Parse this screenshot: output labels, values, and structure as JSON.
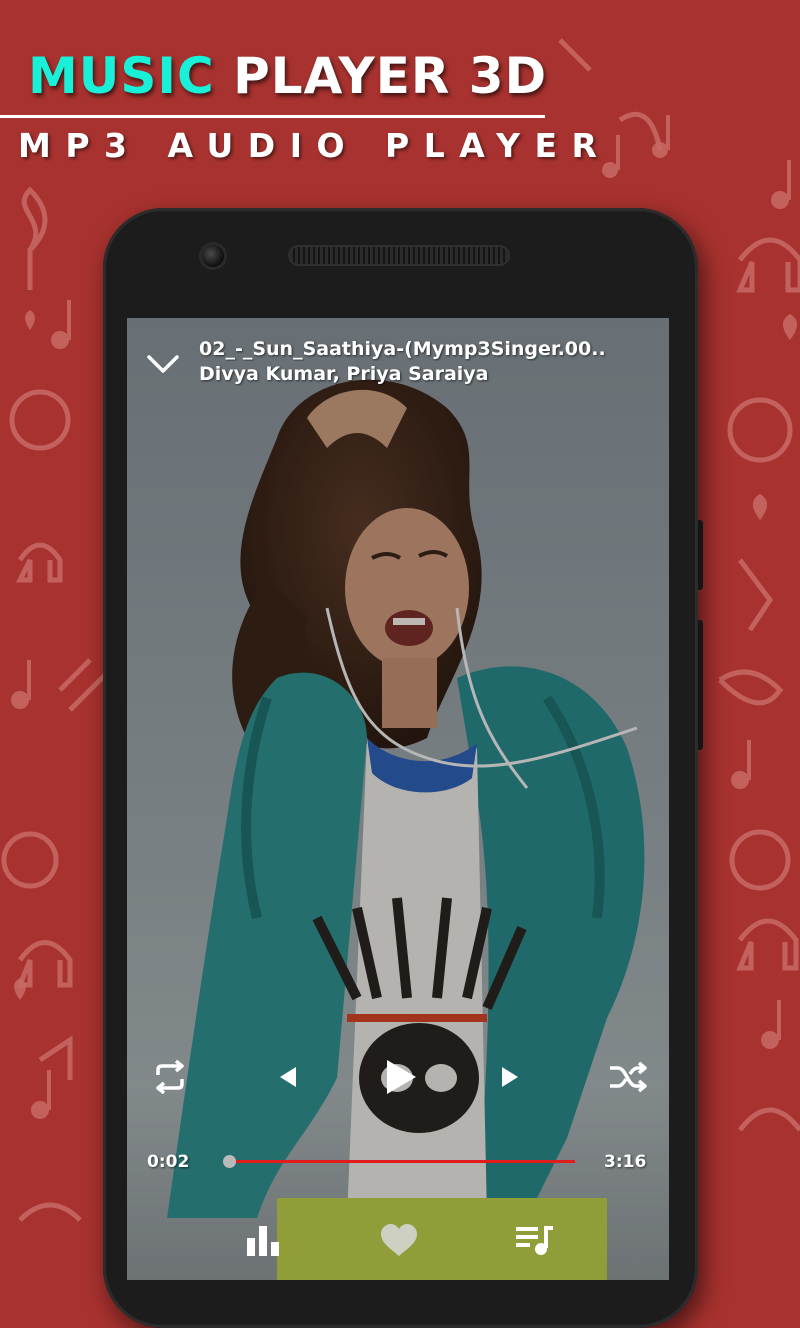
{
  "banner": {
    "title_accent": "MUSIC",
    "title_rest": "PLAYER 3D",
    "subtitle": "MP3 AUDIO PLAYER"
  },
  "player": {
    "song_title": "02_-_Sun_Saathiya-(Mymp3Singer.00..",
    "artist": "Divya Kumar, Priya Saraiya",
    "elapsed": "0:02",
    "duration": "3:16",
    "progress_fraction": 0.01
  },
  "icons": {
    "collapse": "chevron-down-icon",
    "repeat": "repeat-icon",
    "previous": "previous-icon",
    "play": "play-icon",
    "next": "next-icon",
    "shuffle": "shuffle-icon",
    "equalizer": "equalizer-icon",
    "favorite": "heart-icon",
    "playlist": "queue-music-icon"
  },
  "colors": {
    "background": "#a8322f",
    "accent": "#19f0d8",
    "seek_fill": "#e01c1c",
    "text": "#ffffff"
  }
}
